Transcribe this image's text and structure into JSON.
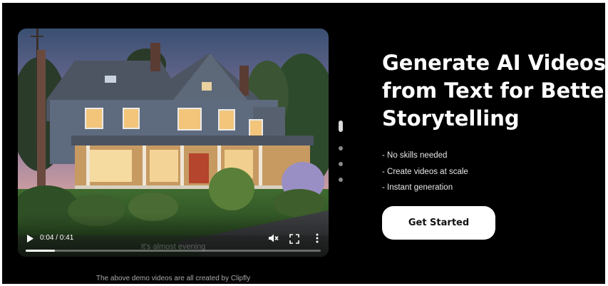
{
  "player": {
    "current_time": "0:04",
    "duration": "0:41",
    "time_display": "0:04 / 0:41",
    "progress": 0.1,
    "subtitle": "It's almost evening"
  },
  "carousel": {
    "slides": 4,
    "active": 0
  },
  "hero": {
    "headline_lines": [
      "Generate AI Videos",
      "from Text for Better",
      "Storytelling"
    ],
    "features": [
      "- No skills needed",
      "- Create videos at scale",
      "- Instant generation"
    ],
    "cta_label": "Get Started"
  },
  "caption": "The above demo videos are all created by Clipfly",
  "icons": {
    "play": "play-icon",
    "mute": "volume-muted-icon",
    "fullscreen": "fullscreen-icon",
    "more": "more-vertical-icon"
  },
  "colors": {
    "background": "#000000",
    "text": "#ffffff",
    "button_bg": "#ffffff",
    "button_text": "#111111"
  }
}
